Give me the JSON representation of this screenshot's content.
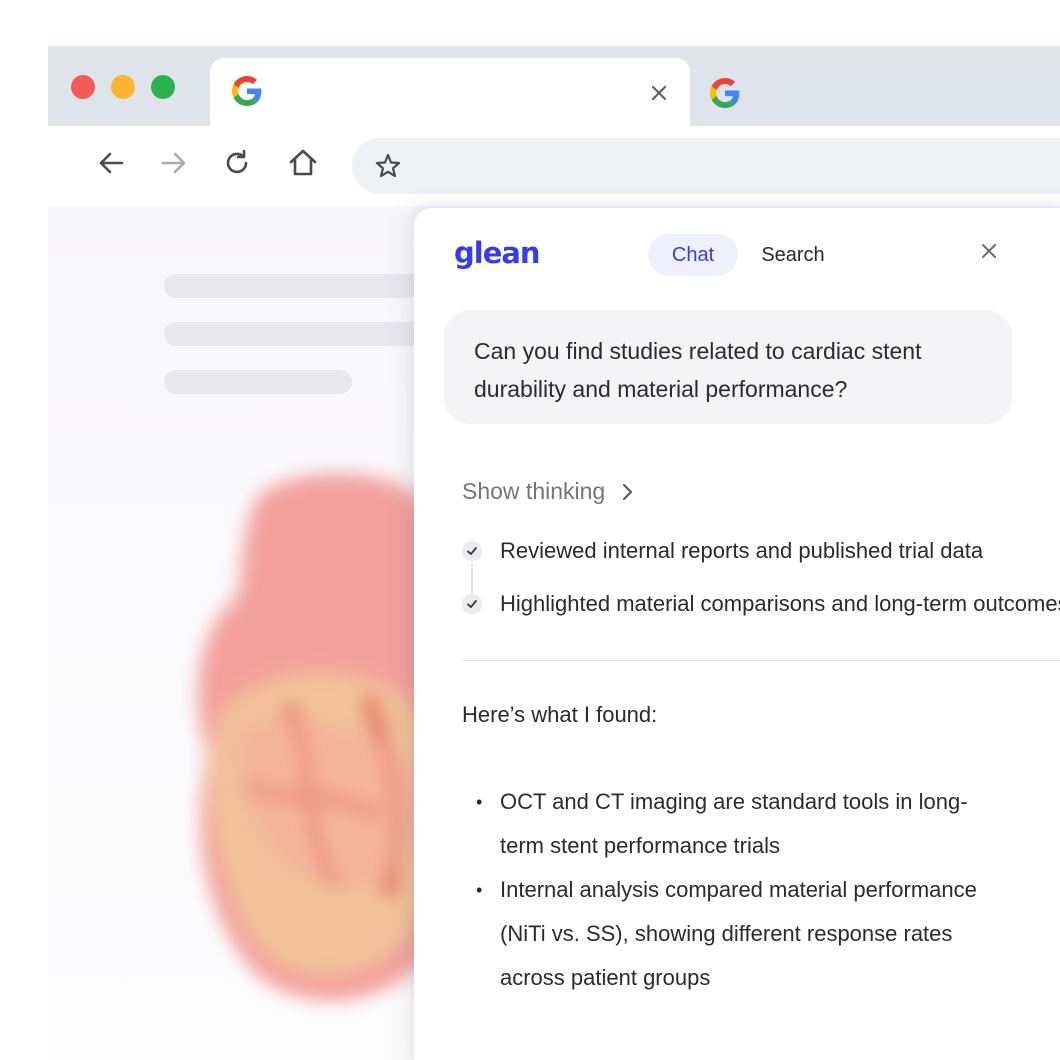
{
  "browser": {
    "active_tab": {
      "icon": "google-g-icon",
      "close_icon": "close-icon"
    },
    "inactive_tab": {
      "icon": "google-g-icon"
    },
    "toolbar": {
      "back_icon": "arrow-left-icon",
      "forward_icon": "arrow-right-icon",
      "reload_icon": "reload-icon",
      "home_icon": "home-icon",
      "bookmark_icon": "star-icon"
    }
  },
  "panel": {
    "logo": "glean",
    "tabs": [
      {
        "label": "Chat",
        "active": true
      },
      {
        "label": "Search",
        "active": false
      }
    ],
    "close_icon": "close-icon",
    "query": "Can you find studies related to cardiac stent durability and material performance?",
    "show_thinking": "Show thinking",
    "steps": [
      "Reviewed internal reports and published trial data",
      "Highlighted material comparisons and long-term outcomes"
    ],
    "intro": "Here’s what I found:",
    "findings": [
      "OCT and CT imaging are standard tools in long-term stent performance trials",
      "Internal analysis compared material performance (NiTi vs. SS), showing different response rates across patient groups"
    ]
  },
  "colors": {
    "brand": "#343ced",
    "chat_tab_bg": "#eef0fd",
    "traffic_red": "#f25b57",
    "traffic_yellow": "#f7b731",
    "traffic_green": "#2ab24f",
    "tabstrip": "#dfe3ea"
  }
}
